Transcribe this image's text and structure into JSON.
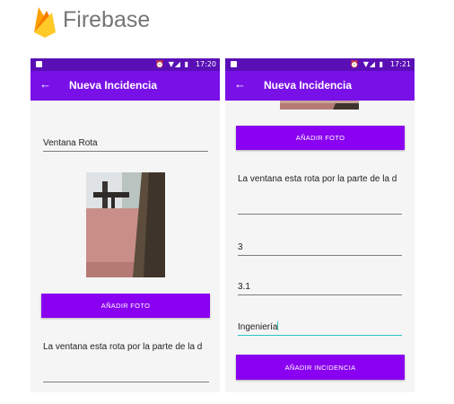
{
  "brand": {
    "name": "Firebase"
  },
  "screens": [
    {
      "status_time": "17:20",
      "title": "Nueva Incidencia",
      "fields": {
        "name": "Ventana Rota",
        "description": "La ventana esta rota por la parte de la d"
      },
      "add_photo_label": "AÑADIR FOTO"
    },
    {
      "status_time": "17:21",
      "title": "Nueva Incidencia",
      "add_photo_label": "AÑADIR FOTO",
      "fields": {
        "description": "La ventana esta rota por la parte de la d",
        "field_a": "3",
        "field_b": "3.1",
        "field_c": "Ingeniería"
      },
      "submit_label": "AÑADIR INCIDENCIA"
    }
  ],
  "icons": {
    "back": "arrow-left-icon",
    "logo": "firebase-flame-icon"
  },
  "colors": {
    "status_bar": "#5a0fb6",
    "app_bar": "#7a10e8",
    "button": "#8a00f0",
    "focus_line": "#2ec4c0"
  }
}
